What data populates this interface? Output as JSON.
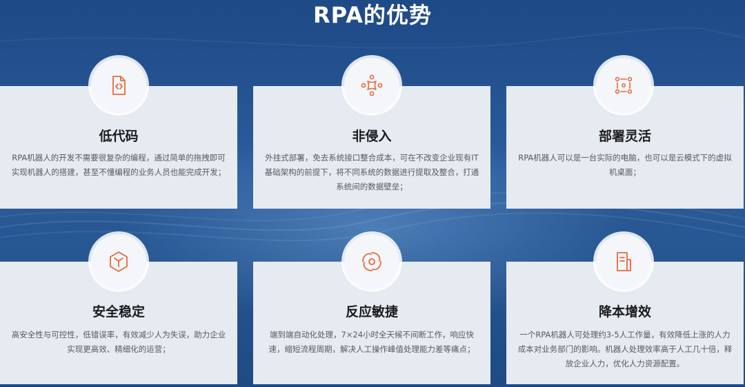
{
  "page": {
    "title": "RPA的优势"
  },
  "cards": [
    {
      "title": "低代码",
      "icon": "code-file-icon",
      "desc": "RPA机器人的开发不需要很复杂的编程，通过简单的拖拽即可实现机器人的搭建，甚至不懂编程的业务人员也能完成开发；"
    },
    {
      "title": "非侵入",
      "icon": "network-nodes-icon",
      "desc": "外挂式部署，免去系统接口整合成本，可在不改变企业现有IT基础架构的前提下，将不同系统的数据进行提取及整合，打通系统间的数据壁垒；"
    },
    {
      "title": "部署灵活",
      "icon": "grid-dots-icon",
      "desc": "RPA机器人可以是一台实际的电脑，也可以是云模式下的虚拟机桌面；"
    },
    {
      "title": "安全稳定",
      "icon": "hexagon-cube-icon",
      "desc": "高安全性与可控性，低错误率，有效减少人为失误，助力企业实现更高效、精细化的运营；"
    },
    {
      "title": "反应敏捷",
      "icon": "swirl-icon",
      "desc": "端到端自动化处理，7×24小时全天候不间断工作，响应快速，缩短流程周期，解决人工操作峰值处理能力差等痛点；"
    },
    {
      "title": "降本增效",
      "icon": "document-icon",
      "desc": "一个RPA机器人可处理约3-5人工作量，有效降低上涨的人力成本对业务部门的影响。机器人处理效率高于人工几十倍，释放企业人力，优化人力资源配置。"
    }
  ],
  "colors": {
    "accent": "#e8683a",
    "background": "#24508a",
    "card": "#e6ebf2"
  }
}
